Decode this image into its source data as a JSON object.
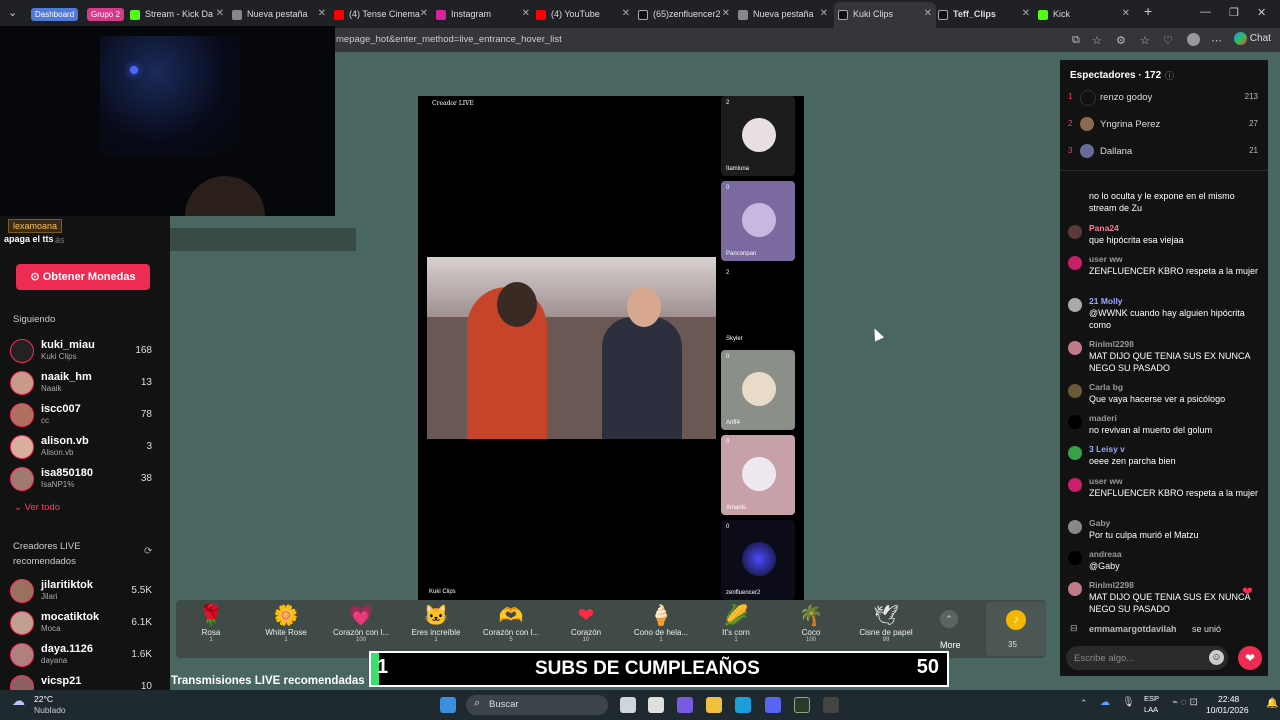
{
  "tabs": {
    "groups": [
      "Dashboard",
      "Grupo 2"
    ],
    "items": [
      {
        "label": "Stream - Kick Da"
      },
      {
        "label": "Nueva pestaña"
      },
      {
        "label": "(4) Tense Cinema"
      },
      {
        "label": "Instagram"
      },
      {
        "label": "(4) YouTube"
      },
      {
        "label": "(65)zenfluencer2"
      },
      {
        "label": "Nueva pestaña"
      },
      {
        "label": "Kuki Clips"
      },
      {
        "label": "Teff_Clips"
      },
      {
        "label": "Kick"
      }
    ],
    "new_tab": "+"
  },
  "address": {
    "url": "mepage_hot&enter_method=live_entrance_hover_list",
    "chat_label": "Chat"
  },
  "overlay": {
    "name": "lexamoana",
    "text": "apaga el tts",
    "text_suffix": "ás"
  },
  "sidebar": {
    "coins_button": "Obtener Monedas",
    "following_title": "Siguiendo",
    "following": [
      {
        "name": "kuki_miau",
        "sub": "Kuki Clips",
        "count": "168"
      },
      {
        "name": "naaik_hm",
        "sub": "Naaik",
        "count": "13"
      },
      {
        "name": "iscc007",
        "sub": "cc",
        "count": "78"
      },
      {
        "name": "alison.vb",
        "sub": "Alison.vb",
        "count": "3"
      },
      {
        "name": "isa850180",
        "sub": "IsaNP1%",
        "count": "38"
      }
    ],
    "see_all": "Ver todo",
    "recommended_title": "Creadores LIVE recomendados",
    "recommended": [
      {
        "name": "jilaritiktok",
        "sub": "Jilari",
        "count": "5.5K"
      },
      {
        "name": "mocatiktok",
        "sub": "Moca",
        "count": "6.1K"
      },
      {
        "name": "daya.1126",
        "sub": "dayana",
        "count": "1.6K"
      },
      {
        "name": "vicsp21",
        "sub": "",
        "count": "10"
      }
    ]
  },
  "player": {
    "creator_label": "Creador LIVE",
    "host_label": "Kuki Clips",
    "guests": [
      {
        "name": "Itamluna",
        "count": "2"
      },
      {
        "name": "Panconpan",
        "count": "0"
      },
      {
        "name": "Skyler",
        "count": "2"
      },
      {
        "name": "Ariff4",
        "count": "0"
      },
      {
        "name": "Amariis",
        "count": "0"
      },
      {
        "name": "zenfluencer2",
        "count": "0"
      }
    ]
  },
  "recommended_section": "Transmisiones LIVE recomendadas",
  "gifts": [
    {
      "name": "Rosa",
      "price": "1",
      "icon": "🌹"
    },
    {
      "name": "White Rose",
      "price": "1",
      "icon": "🌼"
    },
    {
      "name": "Corazón con l...",
      "price": "100",
      "icon": "💗"
    },
    {
      "name": "Eres increíble",
      "price": "1",
      "icon": "🐱"
    },
    {
      "name": "Corazón con l...",
      "price": "5",
      "icon": "🫶"
    },
    {
      "name": "Corazón",
      "price": "10",
      "icon": "❤"
    },
    {
      "name": "Cono de hela...",
      "price": "1",
      "icon": "🍦"
    },
    {
      "name": "It's corn",
      "price": "1",
      "icon": "🌽"
    },
    {
      "name": "Coco",
      "price": "100",
      "icon": "🌴"
    },
    {
      "name": "Cisne de papel",
      "price": "99",
      "icon": "🕊"
    }
  ],
  "gift_more": "More",
  "coin_balance": "35",
  "banner": {
    "left": "1",
    "title": "SUBS DE CUMPLEAÑOS",
    "right": "50"
  },
  "chat": {
    "viewers_label": "Espectadores · 172",
    "top_viewers": [
      {
        "rank": "1",
        "name": "renzo godoy",
        "score": "213"
      },
      {
        "rank": "2",
        "name": "Yngrina Perez",
        "score": "27"
      },
      {
        "rank": "3",
        "name": "Dallana",
        "score": "21"
      }
    ],
    "messages": [
      {
        "user": "",
        "text": "no lo oculta y le expone en el mismo stream de Zu"
      },
      {
        "user": "Pana24",
        "text": "que hipócrita esa viejaa"
      },
      {
        "user": "user ww",
        "text": "ZENFLUENCER KBRO respeta a la mujer"
      },
      {
        "user": "21 Molly",
        "text": "@WWNK cuando hay alguien hipócrita como"
      },
      {
        "user": "Rinlml2298",
        "text": "MAT DIJO QUE TENIA SUS EX NUNCA NEGO SU PASADO"
      },
      {
        "user": "Carla bg",
        "text": "Que vaya hacerse ver a psicólogo"
      },
      {
        "user": "maderi",
        "text": "no revivan al muerto del golum"
      },
      {
        "user": "3 Leisy v",
        "text": "oeee zen parcha bien"
      },
      {
        "user": "user ww",
        "text": "ZENFLUENCER KBRO respeta a la mujer"
      },
      {
        "user": "Gaby",
        "text": "Por tu culpa murió el Matzu"
      },
      {
        "user": "andreaa",
        "text": "@Gaby"
      },
      {
        "user": "Rinlml2298",
        "text": "MAT DIJO QUE TENIA SUS EX NUNCA NEGO SU PASADO"
      }
    ],
    "join_user": "emmamargotdavilah",
    "join_text": "se unió",
    "input_placeholder": "Escribe algo..."
  },
  "taskbar": {
    "weather_temp": "22°C",
    "weather_desc": "Nublado",
    "search": "Buscar",
    "lang": "ESP",
    "lang2": "LAA",
    "time": "22:48",
    "date": "10/01/2026"
  }
}
